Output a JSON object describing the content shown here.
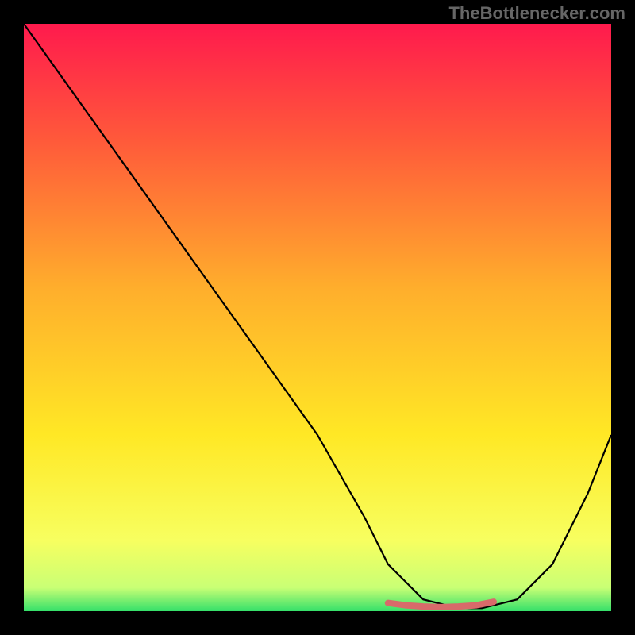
{
  "watermark": "TheBottlenecker.com",
  "chart_data": {
    "type": "line",
    "title": "",
    "xlabel": "",
    "ylabel": "",
    "xlim": [
      0,
      100
    ],
    "ylim": [
      0,
      100
    ],
    "gradient_stops": [
      {
        "offset": 0.0,
        "color": "#ff1a4d"
      },
      {
        "offset": 0.2,
        "color": "#ff5a3a"
      },
      {
        "offset": 0.45,
        "color": "#ffae2c"
      },
      {
        "offset": 0.7,
        "color": "#ffe825"
      },
      {
        "offset": 0.88,
        "color": "#f7ff60"
      },
      {
        "offset": 0.96,
        "color": "#c9ff75"
      },
      {
        "offset": 1.0,
        "color": "#35e06a"
      }
    ],
    "curve": {
      "x": [
        0,
        5,
        10,
        20,
        30,
        40,
        50,
        58,
        62,
        68,
        74,
        78,
        84,
        90,
        96,
        100
      ],
      "y": [
        100,
        93,
        86,
        72,
        58,
        44,
        30,
        16,
        8,
        2,
        0.5,
        0.5,
        2,
        8,
        20,
        30
      ]
    },
    "highlight": {
      "x": [
        62,
        65,
        68,
        71,
        74,
        77,
        80
      ],
      "y": [
        1.4,
        1.0,
        0.8,
        0.7,
        0.8,
        1.0,
        1.6
      ],
      "color": "#d86a6a"
    }
  }
}
